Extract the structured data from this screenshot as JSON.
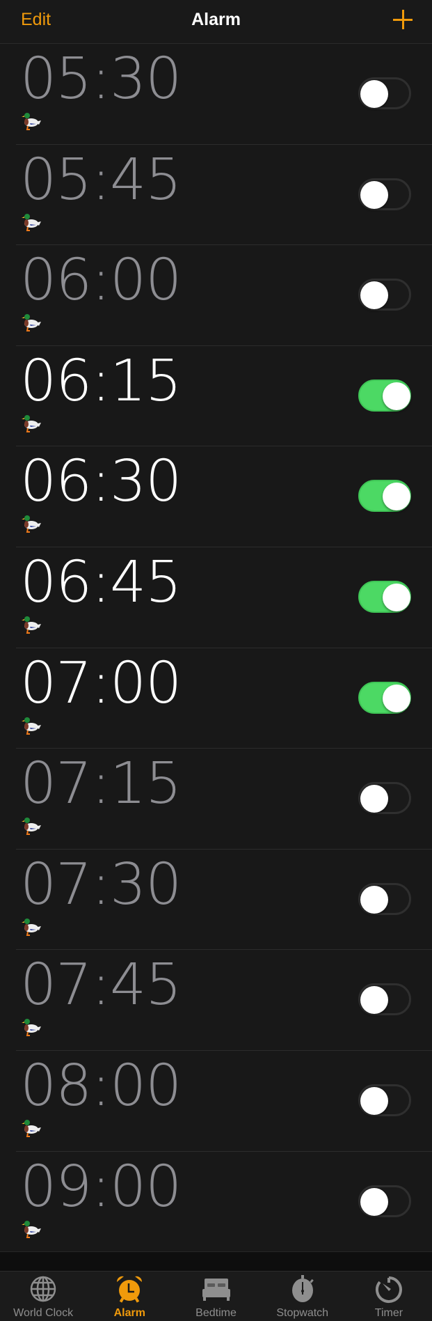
{
  "header": {
    "edit_label": "Edit",
    "title": "Alarm",
    "add_icon": "plus-icon"
  },
  "colors": {
    "accent": "#f09a0b",
    "toggle_on": "#4cd964",
    "time_on": "#ffffff",
    "time_off": "#8d8d92",
    "background": "#181818"
  },
  "alarms": [
    {
      "time": "05:30",
      "label_icon": "duck-emoji",
      "enabled": false
    },
    {
      "time": "05:45",
      "label_icon": "duck-emoji",
      "enabled": false
    },
    {
      "time": "06:00",
      "label_icon": "duck-emoji",
      "enabled": false
    },
    {
      "time": "06:15",
      "label_icon": "duck-emoji",
      "enabled": true
    },
    {
      "time": "06:30",
      "label_icon": "duck-emoji",
      "enabled": true
    },
    {
      "time": "06:45",
      "label_icon": "duck-emoji",
      "enabled": true
    },
    {
      "time": "07:00",
      "label_icon": "duck-emoji",
      "enabled": true
    },
    {
      "time": "07:15",
      "label_icon": "duck-emoji",
      "enabled": false
    },
    {
      "time": "07:30",
      "label_icon": "duck-emoji",
      "enabled": false
    },
    {
      "time": "07:45",
      "label_icon": "duck-emoji",
      "enabled": false
    },
    {
      "time": "08:00",
      "label_icon": "duck-emoji",
      "enabled": false
    },
    {
      "time": "09:00",
      "label_icon": "duck-emoji",
      "enabled": false
    }
  ],
  "tabbar": {
    "active": "alarm",
    "tabs": [
      {
        "id": "world-clock",
        "label": "World Clock",
        "icon": "globe-icon"
      },
      {
        "id": "alarm",
        "label": "Alarm",
        "icon": "alarm-clock-icon"
      },
      {
        "id": "bedtime",
        "label": "Bedtime",
        "icon": "bed-icon"
      },
      {
        "id": "stopwatch",
        "label": "Stopwatch",
        "icon": "stopwatch-icon"
      },
      {
        "id": "timer",
        "label": "Timer",
        "icon": "timer-icon"
      }
    ]
  }
}
